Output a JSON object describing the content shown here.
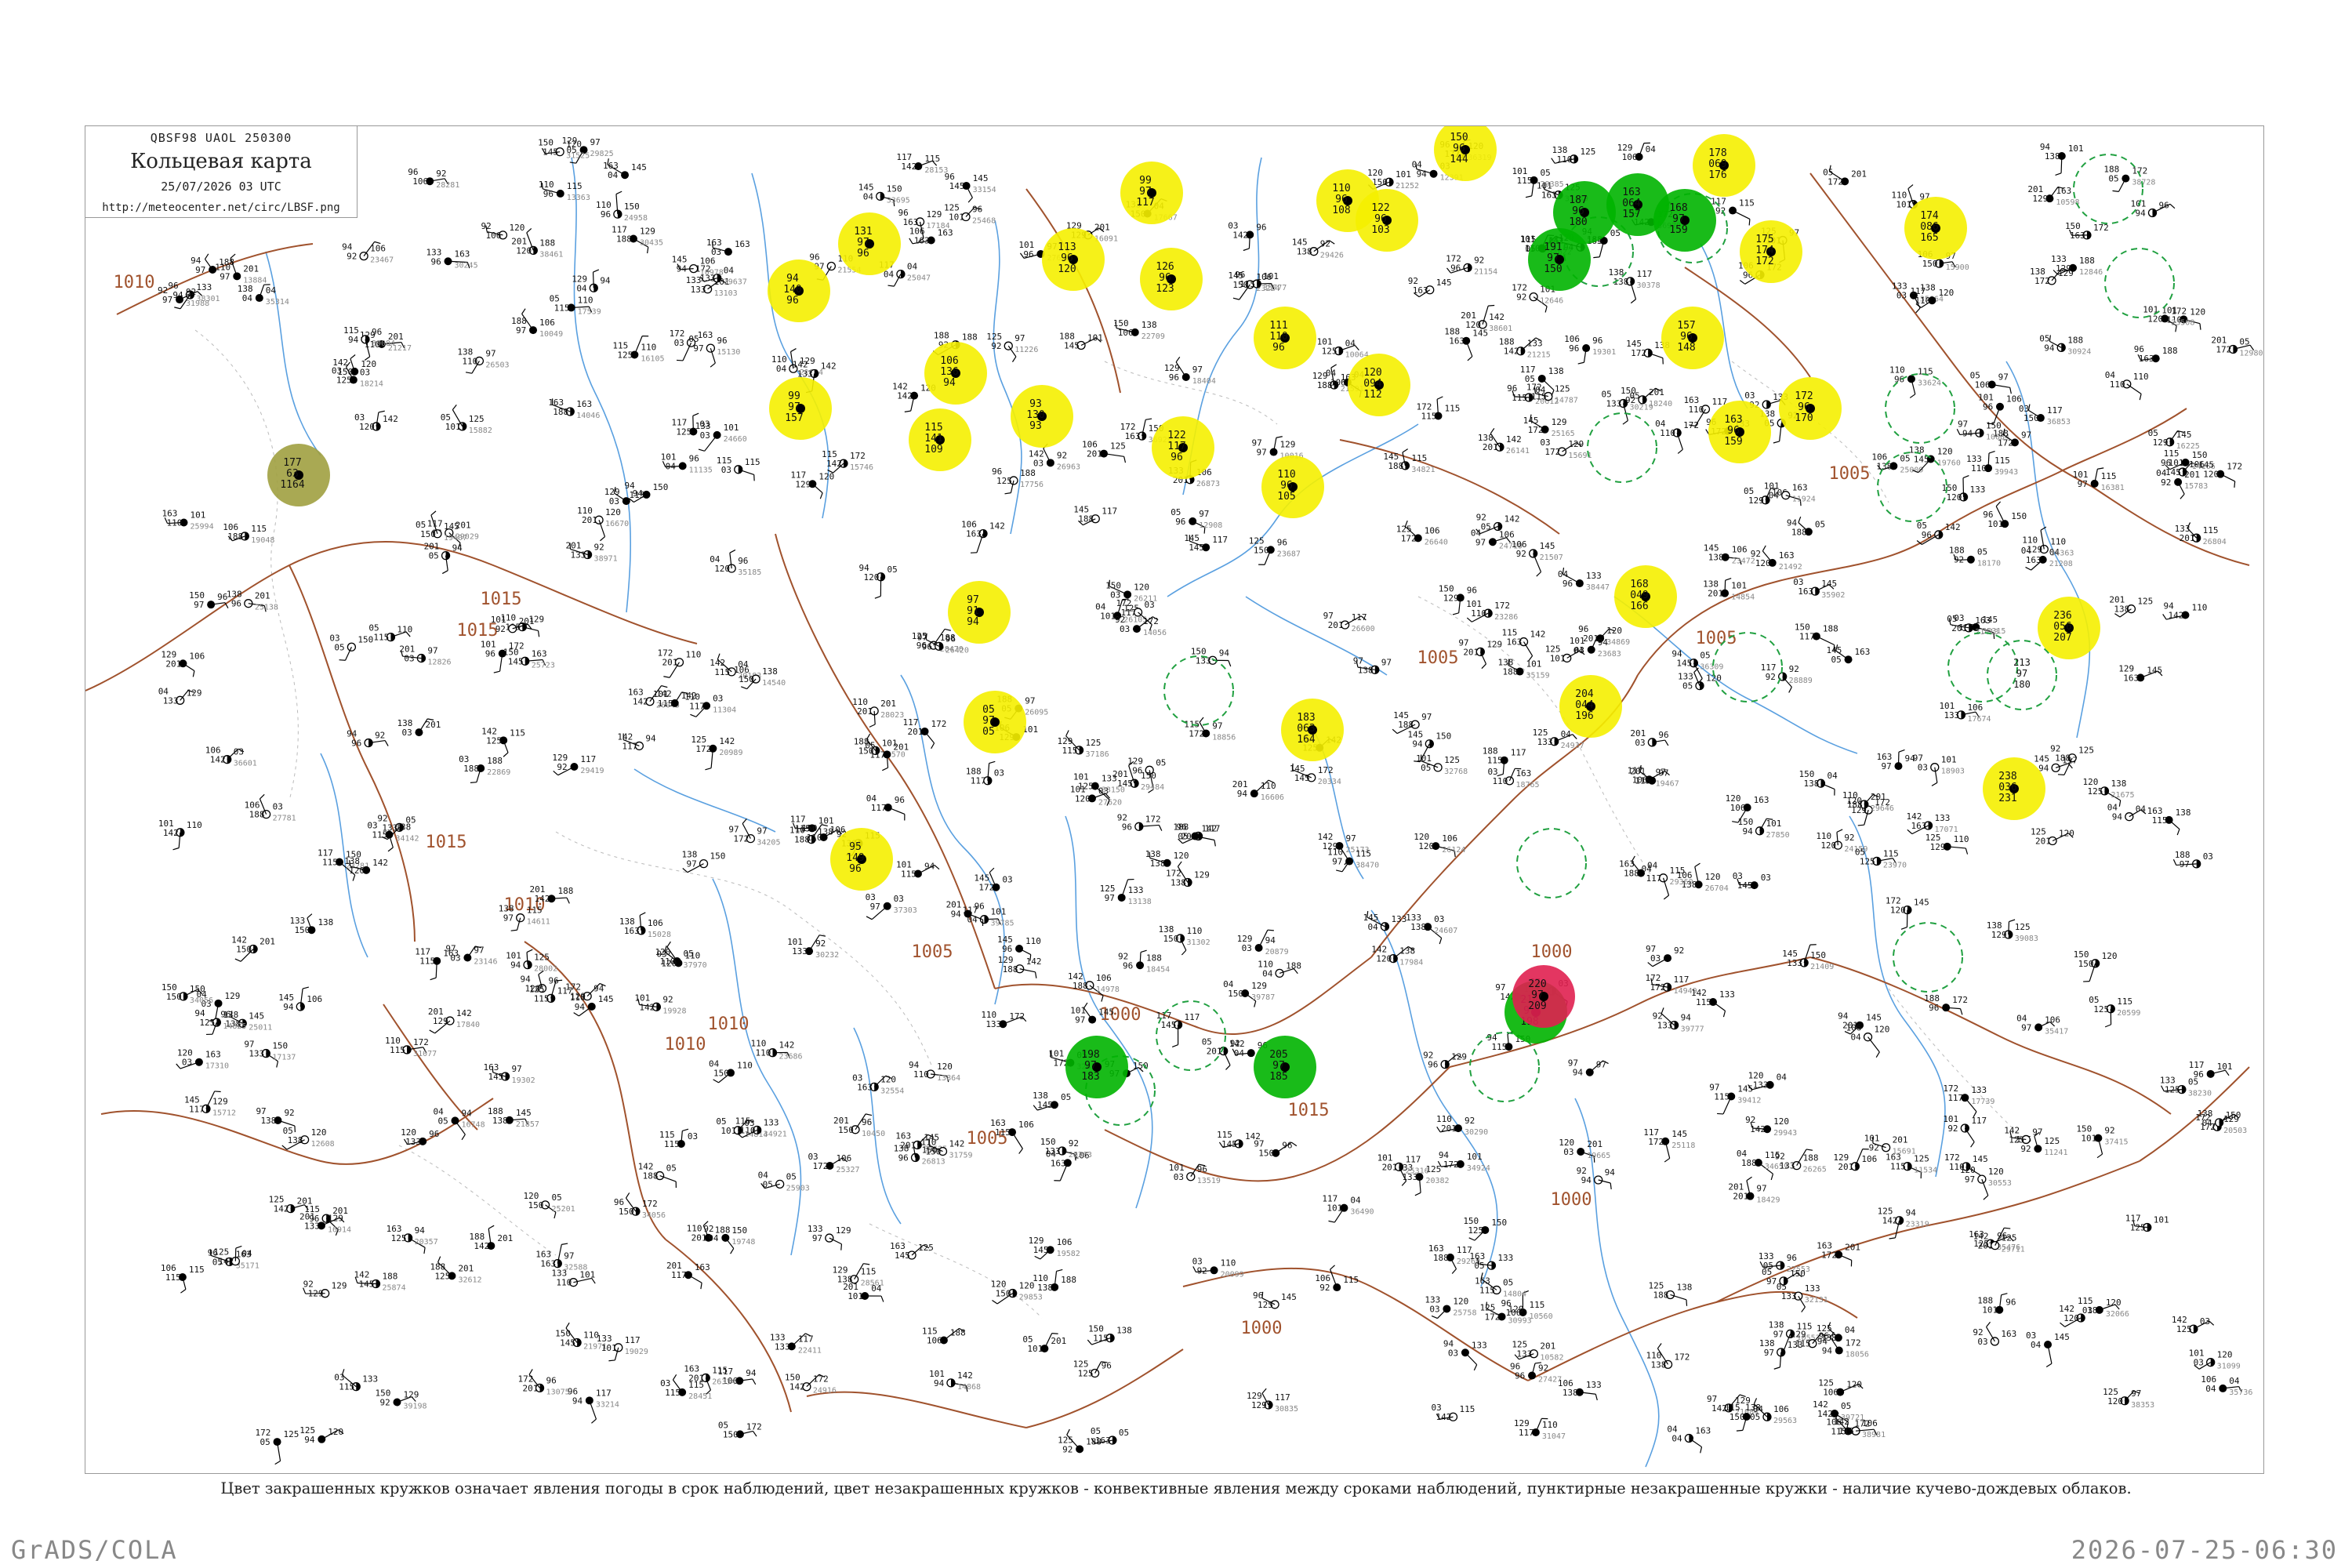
{
  "header": {
    "code_line": "QBSF98  UAOL  250300",
    "title": "Кольцевая карта",
    "date_line": "25/07/2026 03 UTC",
    "url": "http://meteocenter.net/circ/LBSF.png"
  },
  "caption": "Цвет закрашенных кружков означает явления погоды в срок наблюдений, цвет незакрашенных кружков - конвективные явления между сроками наблюдений, пунктирные незакрашенные кружки - наличие кучево-дождевых облаков.",
  "footer": {
    "left": "GrADS/COLA",
    "right": "2026-07-25-06:30"
  },
  "colors": {
    "isobar": "#a0522d",
    "river": "#5aa0e0",
    "yellow_fill": "#f5f000",
    "green_fill": "#00b400",
    "red_fill": "#e02050",
    "olive_fill": "#a0a040",
    "dashed_ring": "#20a040"
  },
  "isobar_labels": [
    "1010",
    "1015",
    "1015",
    "1010",
    "1015",
    "1010",
    "1010",
    "1005",
    "1005",
    "1005",
    "1005",
    "1000",
    "1000",
    "1000",
    "1000",
    "1005",
    "1015"
  ],
  "highlighted_stations": [
    {
      "kind": "yellow",
      "values": [
        "177",
        "63",
        "1164"
      ]
    },
    {
      "kind": "yellow",
      "values": [
        "99",
        "97",
        "117"
      ]
    },
    {
      "kind": "yellow",
      "values": [
        "131",
        "97",
        "96"
      ]
    },
    {
      "kind": "yellow",
      "values": [
        "113",
        "96",
        "120"
      ]
    },
    {
      "kind": "yellow",
      "values": [
        "126",
        "96",
        "123"
      ]
    },
    {
      "kind": "yellow",
      "values": [
        "94",
        "140",
        "96"
      ]
    },
    {
      "kind": "yellow",
      "values": [
        "110",
        "96",
        "108"
      ]
    },
    {
      "kind": "yellow",
      "values": [
        "122",
        "96",
        "103"
      ]
    },
    {
      "kind": "yellow",
      "values": [
        "150",
        "96",
        "144"
      ]
    },
    {
      "kind": "yellow",
      "values": [
        "178",
        "069",
        "176"
      ]
    },
    {
      "kind": "yellow",
      "values": [
        "174",
        "086",
        "165"
      ]
    },
    {
      "kind": "yellow",
      "values": [
        "157",
        "96",
        "148"
      ]
    },
    {
      "kind": "yellow",
      "values": [
        "163",
        "96",
        "159"
      ]
    },
    {
      "kind": "yellow",
      "values": [
        "168",
        "049",
        "166"
      ]
    },
    {
      "kind": "yellow",
      "values": [
        "204",
        "044",
        "196"
      ]
    },
    {
      "kind": "yellow",
      "values": [
        "183",
        "063",
        "164"
      ]
    },
    {
      "kind": "yellow",
      "values": [
        "236",
        "056",
        "207"
      ]
    },
    {
      "kind": "yellow",
      "values": [
        "238",
        "036",
        "231"
      ]
    },
    {
      "kind": "yellow",
      "values": [
        "95",
        "149",
        "96"
      ]
    },
    {
      "kind": "yellow",
      "values": [
        "05",
        "97",
        "05"
      ]
    },
    {
      "kind": "yellow",
      "values": [
        "97",
        "91",
        "94"
      ]
    },
    {
      "kind": "yellow",
      "values": [
        "115",
        "141",
        "109"
      ]
    },
    {
      "kind": "yellow",
      "values": [
        "93",
        "130",
        "93"
      ]
    },
    {
      "kind": "yellow",
      "values": [
        "122",
        "117",
        "96"
      ]
    },
    {
      "kind": "yellow",
      "values": [
        "111",
        "110",
        "96"
      ]
    },
    {
      "kind": "yellow",
      "values": [
        "120",
        "094",
        "112"
      ]
    },
    {
      "kind": "yellow",
      "values": [
        "110",
        "96",
        "105"
      ]
    },
    {
      "kind": "yellow",
      "values": [
        "99",
        "97",
        "157"
      ]
    },
    {
      "kind": "yellow",
      "values": [
        "106",
        "136",
        "94"
      ]
    },
    {
      "kind": "yellow",
      "values": [
        "175",
        "174",
        "172"
      ]
    },
    {
      "kind": "yellow",
      "values": [
        "172",
        "96",
        "170"
      ]
    },
    {
      "kind": "green",
      "values": [
        "187",
        "96",
        "180"
      ]
    },
    {
      "kind": "green",
      "values": [
        "163",
        "064",
        "157"
      ]
    },
    {
      "kind": "green",
      "values": [
        "168",
        "97",
        "159"
      ]
    },
    {
      "kind": "green",
      "values": [
        "191",
        "97",
        "150"
      ]
    },
    {
      "kind": "green",
      "values": [
        "198",
        "97",
        "183"
      ]
    },
    {
      "kind": "green",
      "values": [
        "214",
        "97",
        "198"
      ]
    },
    {
      "kind": "green",
      "values": [
        "205",
        "97",
        "185"
      ]
    },
    {
      "kind": "red",
      "values": [
        "220",
        "97",
        "209"
      ]
    }
  ],
  "dashed_station_values": [
    "213",
    "97",
    "180"
  ]
}
